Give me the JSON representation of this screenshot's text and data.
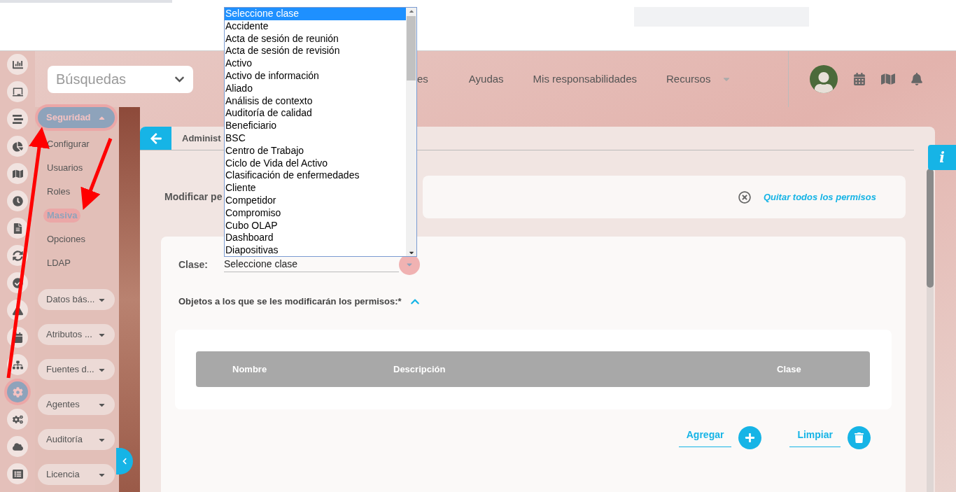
{
  "rail": [
    {
      "selected": false
    },
    {
      "selected": false
    },
    {
      "selected": false
    },
    {
      "selected": false
    },
    {
      "selected": false
    },
    {
      "selected": false
    },
    {
      "selected": false
    },
    {
      "selected": false
    },
    {
      "selected": false
    },
    {
      "selected": false
    },
    {
      "selected": false
    },
    {
      "selected": false
    },
    {
      "selected": true
    },
    {
      "selected": false
    },
    {
      "selected": false
    },
    {
      "selected": false
    }
  ],
  "search": {
    "value": "Búsquedas"
  },
  "nav": [
    {
      "label": "es",
      "has_menu": false
    },
    {
      "label": "Ayudas",
      "has_menu": false
    },
    {
      "label": "Mis responsabilidades",
      "has_menu": false
    },
    {
      "label": "Recursos",
      "has_menu": true
    }
  ],
  "menu": [
    {
      "label": "Seguridad",
      "expanded": true,
      "children": [
        {
          "label": "Configurar",
          "selected": false
        },
        {
          "label": "Usuarios",
          "selected": false
        },
        {
          "label": "Roles",
          "selected": false
        },
        {
          "label": "Masiva",
          "selected": true
        },
        {
          "label": "Opciones",
          "selected": false
        },
        {
          "label": "LDAP",
          "selected": false
        }
      ]
    },
    {
      "label": "Datos bás...",
      "expanded": false
    },
    {
      "label": "Atributos ...",
      "expanded": false
    },
    {
      "label": "Fuentes d...",
      "expanded": false
    },
    {
      "label": "Agentes",
      "expanded": false
    },
    {
      "label": "Auditoría",
      "expanded": false
    },
    {
      "label": "Licencia",
      "expanded": false
    }
  ],
  "page": {
    "title": "Administ",
    "section_label": "Modificar pe",
    "remove_all_link": "Quitar todos los permisos"
  },
  "form": {
    "class_label": "Clase:",
    "class_value": "Seleccione clase",
    "objects_label": "Objetos a los que se les modificarán los permisos:*",
    "objects_expanded": true
  },
  "table": {
    "columns": [
      "Nombre",
      "Descripción",
      "Clase"
    ]
  },
  "actions": [
    "Agregar",
    "Limpiar"
  ],
  "dropdown": {
    "options": [
      {
        "label": "Seleccione clase",
        "selected": true
      },
      {
        "label": "Accidente",
        "selected": false
      },
      {
        "label": "Acta de sesión de reunión",
        "selected": false
      },
      {
        "label": "Acta de sesión de revisión",
        "selected": false
      },
      {
        "label": "Activo",
        "selected": false
      },
      {
        "label": "Activo de información",
        "selected": false
      },
      {
        "label": "Aliado",
        "selected": false
      },
      {
        "label": "Análisis de contexto",
        "selected": false
      },
      {
        "label": "Auditoría de calidad",
        "selected": false
      },
      {
        "label": "Beneficiario",
        "selected": false
      },
      {
        "label": "BSC",
        "selected": false
      },
      {
        "label": "Centro de Trabajo",
        "selected": false
      },
      {
        "label": "Ciclo de Vida del Activo",
        "selected": false
      },
      {
        "label": "Clasificación de enfermedades",
        "selected": false
      },
      {
        "label": "Cliente",
        "selected": false
      },
      {
        "label": "Competidor",
        "selected": false
      },
      {
        "label": "Compromiso",
        "selected": false
      },
      {
        "label": "Cubo OLAP",
        "selected": false
      },
      {
        "label": "Dashboard",
        "selected": false
      },
      {
        "label": "Diapositivas",
        "selected": false
      }
    ]
  },
  "info_tab": "i"
}
